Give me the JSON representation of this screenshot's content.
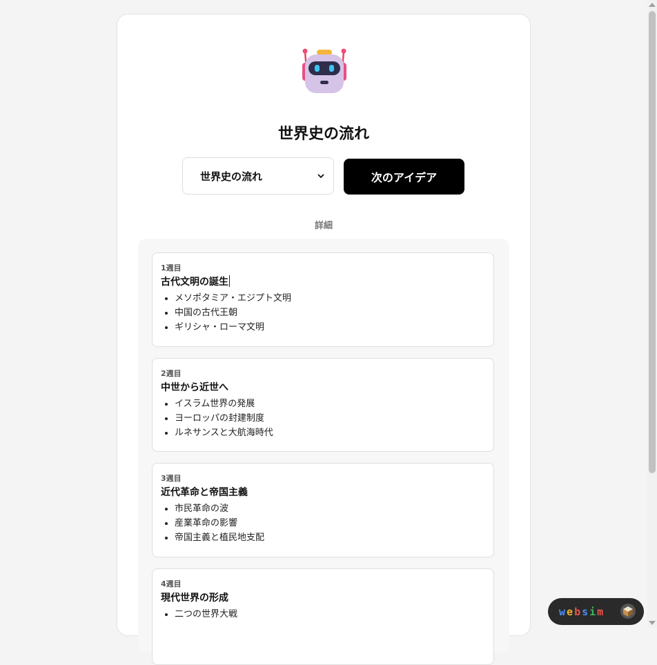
{
  "header": {
    "title": "世界史の流れ"
  },
  "controls": {
    "select_value": "世界史の流れ",
    "next_button": "次のアイデア"
  },
  "detail_label": "詳細",
  "weeks": [
    {
      "label": "1週目",
      "title": "古代文明の誕生",
      "items": [
        "メソポタミア・エジプト文明",
        "中国の古代王朝",
        "ギリシャ・ローマ文明"
      ]
    },
    {
      "label": "2週目",
      "title": "中世から近世へ",
      "items": [
        "イスラム世界の発展",
        "ヨーロッパの封建制度",
        "ルネサンスと大航海時代"
      ]
    },
    {
      "label": "3週目",
      "title": "近代革命と帝国主義",
      "items": [
        "市民革命の波",
        "産業革命の影響",
        "帝国主義と植民地支配"
      ]
    },
    {
      "label": "4週目",
      "title": "現代世界の形成",
      "items": [
        "二つの世界大戦"
      ]
    }
  ],
  "badge": {
    "letters": [
      "w",
      "e",
      "b",
      "s",
      "i",
      "m"
    ],
    "colors": [
      "#4a8ff7",
      "#f0b429",
      "#e8554e",
      "#4a8ff7",
      "#3bb85a",
      "#e8554e"
    ]
  },
  "icons": {
    "bot": "robot-icon",
    "select": "chevron-down-icon",
    "badge": "cube-icon"
  }
}
